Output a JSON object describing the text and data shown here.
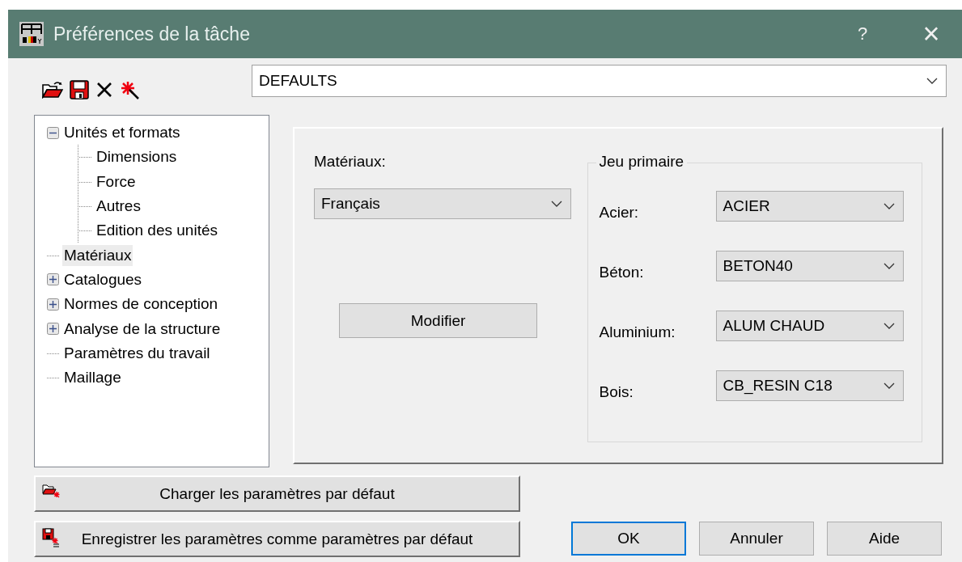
{
  "window": {
    "title": "Préférences de la tâche",
    "help": "?",
    "close": "×"
  },
  "preset": {
    "value": "DEFAULTS"
  },
  "tree": [
    {
      "label": "Unités et formats",
      "kind": "branch",
      "expanded": true,
      "selected": false,
      "children": [
        {
          "label": "Dimensions",
          "kind": "leaf",
          "selected": false
        },
        {
          "label": "Force",
          "kind": "leaf",
          "selected": false
        },
        {
          "label": "Autres",
          "kind": "leaf",
          "selected": false
        },
        {
          "label": "Edition des unités",
          "kind": "leaf",
          "selected": false
        }
      ]
    },
    {
      "label": "Matériaux",
      "kind": "leaf",
      "selected": true
    },
    {
      "label": "Catalogues",
      "kind": "branch",
      "expanded": false,
      "selected": false
    },
    {
      "label": "Normes de conception",
      "kind": "branch",
      "expanded": false,
      "selected": false
    },
    {
      "label": "Analyse de la structure",
      "kind": "branch",
      "expanded": false,
      "selected": false
    },
    {
      "label": "Paramètres du travail",
      "kind": "leaf",
      "selected": false
    },
    {
      "label": "Maillage",
      "kind": "leaf",
      "selected": false
    }
  ],
  "materials": {
    "label": "Matériaux:",
    "value": "Français",
    "button": "Modifier"
  },
  "primary_set": {
    "title": "Jeu primaire",
    "rows": [
      {
        "label": "Acier:",
        "value": "ACIER"
      },
      {
        "label": "Béton:",
        "value": "BETON40"
      },
      {
        "label": "Aluminium:",
        "value": "ALUM CHAUD"
      },
      {
        "label": "Bois:",
        "value": "CB_RESIN C18"
      }
    ]
  },
  "default_buttons": [
    {
      "kind": "load",
      "label": "Charger les paramètres par défaut"
    },
    {
      "kind": "save",
      "label": "Enregistrer les paramètres comme paramètres par défaut"
    }
  ],
  "buttons": [
    {
      "label": "OK",
      "default": true
    },
    {
      "label": "Annuler",
      "default": false
    },
    {
      "label": "Aide",
      "default": false
    }
  ]
}
